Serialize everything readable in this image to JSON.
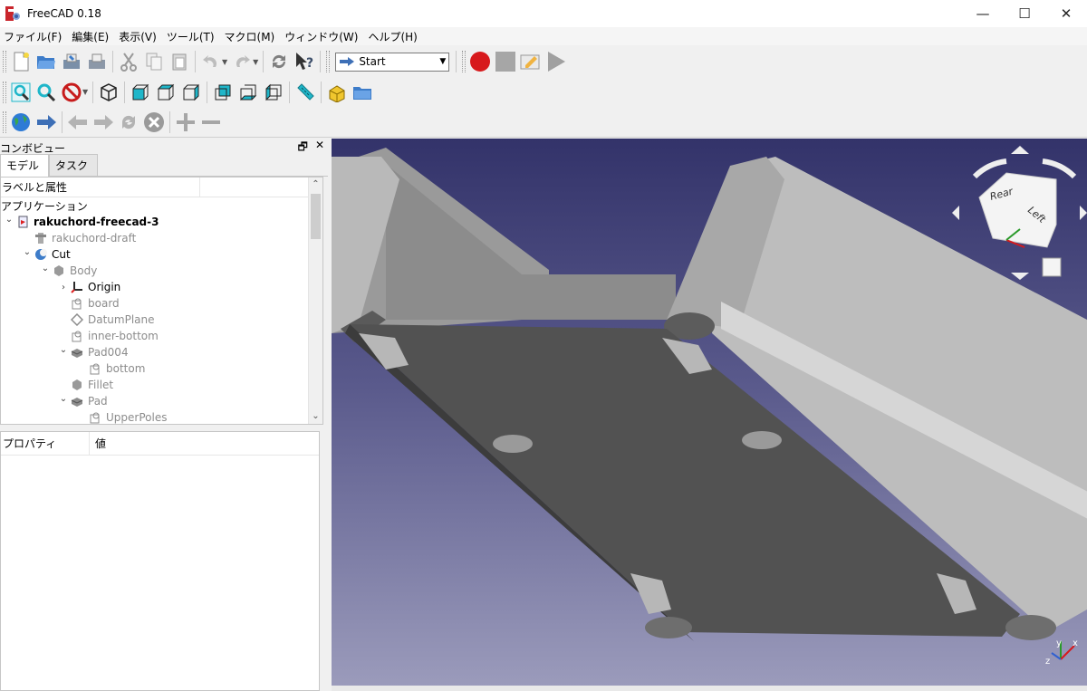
{
  "window": {
    "title": "FreeCAD 0.18",
    "minimize": "—",
    "maximize": "☐",
    "close": "✕"
  },
  "menu": [
    "ファイル(F)",
    "編集(E)",
    "表示(V)",
    "ツール(T)",
    "マクロ(M)",
    "ウィンドウ(W)",
    "ヘルプ(H)"
  ],
  "toolbar": {
    "workbench_selected": "Start"
  },
  "combo": {
    "title": "コンボビュー",
    "tabs": [
      "モデル",
      "タスク"
    ],
    "tree_header": "ラベルと属性",
    "section": "アプリケーション",
    "tree": [
      {
        "label": "rakuchord-freecad-3",
        "indent": 0,
        "chev": "v",
        "icon": "doc",
        "style": "bold"
      },
      {
        "label": "rakuchord-draft",
        "indent": 1,
        "chev": "",
        "icon": "draft",
        "style": "grey"
      },
      {
        "label": "Cut",
        "indent": 1,
        "chev": "v",
        "icon": "cut",
        "style": ""
      },
      {
        "label": "Body",
        "indent": 2,
        "chev": "v",
        "icon": "body",
        "style": "grey"
      },
      {
        "label": "Origin",
        "indent": 3,
        "chev": ">",
        "icon": "origin",
        "style": ""
      },
      {
        "label": "board",
        "indent": 3,
        "chev": "",
        "icon": "sketch",
        "style": "grey"
      },
      {
        "label": "DatumPlane",
        "indent": 3,
        "chev": "",
        "icon": "datum",
        "style": "grey"
      },
      {
        "label": "inner-bottom",
        "indent": 3,
        "chev": "",
        "icon": "sketch",
        "style": "grey"
      },
      {
        "label": "Pad004",
        "indent": 3,
        "chev": "v",
        "icon": "pad",
        "style": "grey"
      },
      {
        "label": "bottom",
        "indent": 4,
        "chev": "",
        "icon": "sketch",
        "style": "grey"
      },
      {
        "label": "Fillet",
        "indent": 3,
        "chev": "",
        "icon": "fillet",
        "style": "grey"
      },
      {
        "label": "Pad",
        "indent": 3,
        "chev": "v",
        "icon": "pad",
        "style": "grey"
      },
      {
        "label": "UpperPoles",
        "indent": 4,
        "chev": "",
        "icon": "sketch",
        "style": "grey"
      }
    ],
    "props_col1": "プロパティ",
    "props_col2": "値"
  },
  "navcube": {
    "face_rear": "Rear",
    "face_left": "Left"
  },
  "axis": {
    "x": "x",
    "y": "y",
    "z": "z"
  },
  "colors": {
    "record": "#d7191c",
    "accent_cyan": "#1fb6c9"
  }
}
